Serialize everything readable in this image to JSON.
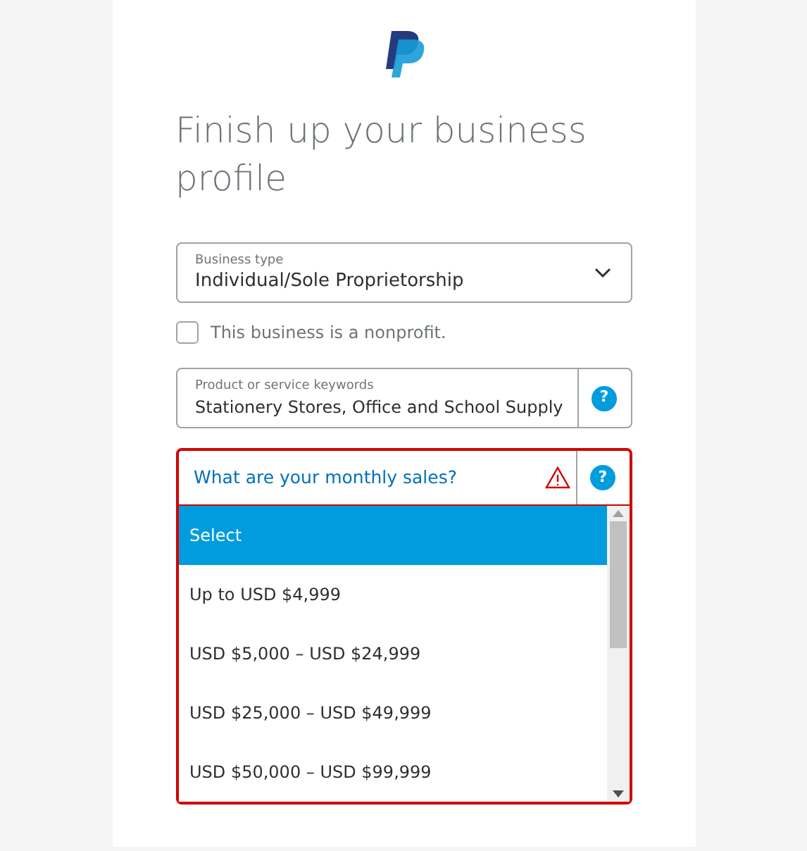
{
  "heading": "Finish up your business profile",
  "business_type": {
    "label": "Business type",
    "value": "Individual/Sole Proprietorship"
  },
  "nonprofit": {
    "label": "This business is a nonprofit.",
    "checked": false
  },
  "keywords": {
    "label": "Product or service keywords",
    "value": "Stationery Stores, Office and School Supply",
    "help": "?"
  },
  "monthly_sales": {
    "placeholder": "What are your monthly sales?",
    "invalid": true,
    "help": "?",
    "options": [
      {
        "label": "Select",
        "selected": true
      },
      {
        "label": "Up to USD $4,999",
        "selected": false
      },
      {
        "label": "USD $5,000 – USD $24,999",
        "selected": false
      },
      {
        "label": "USD $25,000 – USD $49,999",
        "selected": false
      },
      {
        "label": "USD $50,000 – USD $99,999",
        "selected": false
      }
    ]
  }
}
